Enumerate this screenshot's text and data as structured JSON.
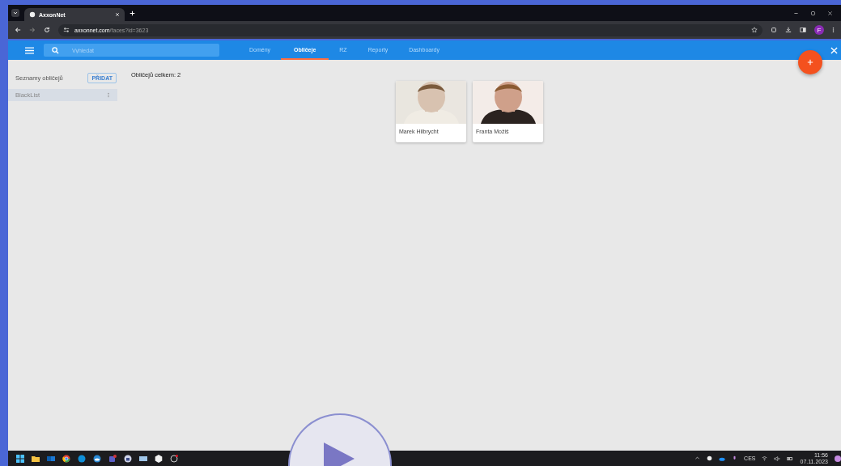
{
  "browser": {
    "tab_title": "AxxonNet",
    "url_host": "axxonnet.com",
    "url_path": "/faces?id=3623",
    "profile_initial": "F"
  },
  "app": {
    "search": {
      "placeholder": "Vyhledat"
    },
    "nav_tabs": [
      {
        "label": "Domény",
        "selected": false
      },
      {
        "label": "Obličeje",
        "selected": true
      },
      {
        "label": "RZ",
        "selected": false
      },
      {
        "label": "Reporty",
        "selected": false
      },
      {
        "label": "Dashboardy",
        "selected": false
      }
    ]
  },
  "sidebar": {
    "title": "Seznamy obličejů",
    "add_button": "PŘIDAT",
    "lists": [
      {
        "label": "BlackList",
        "selected": true
      }
    ]
  },
  "main": {
    "count_text": "Obličejů celkem: 2",
    "faces": [
      {
        "name": "Marek Hilbrycht",
        "kind": "picture"
      },
      {
        "name": "Franta Možiš",
        "kind": "picture"
      }
    ]
  },
  "taskbar": {
    "language": "CES",
    "time": "11:56",
    "date": "07.11.2023"
  }
}
